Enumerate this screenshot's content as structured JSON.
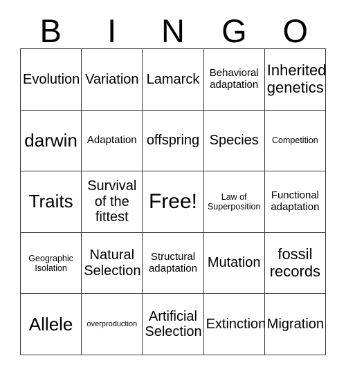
{
  "card": {
    "title": "BINGO",
    "background_color": "#ffffff",
    "border_color": "#3a3a3a",
    "text_color": "#000000"
  },
  "header": {
    "letters": [
      {
        "label": "B"
      },
      {
        "label": "I"
      },
      {
        "label": "N"
      },
      {
        "label": "G"
      },
      {
        "label": "O"
      }
    ]
  },
  "grid": {
    "rows": 5,
    "columns": 5,
    "cells": [
      {
        "label": "Evolution",
        "size": "sz-md"
      },
      {
        "label": "Variation",
        "size": "sz-md"
      },
      {
        "label": "Lamarck",
        "size": "sz-md"
      },
      {
        "label": "Behavioral\nadaptation",
        "size": "sz-xs"
      },
      {
        "label": "Inherited\ngenetics",
        "size": "sz-ml"
      },
      {
        "label": "darwin",
        "size": "sz-lg"
      },
      {
        "label": "Adaptation",
        "size": "sz-xs"
      },
      {
        "label": "offspring",
        "size": "sz-md"
      },
      {
        "label": "Species",
        "size": "sz-md"
      },
      {
        "label": "Competition",
        "size": "sz-xxs"
      },
      {
        "label": "Traits",
        "size": "sz-lg"
      },
      {
        "label": "Survival\nof the\nfittest",
        "size": "sz-md"
      },
      {
        "label": "Free!",
        "size": "sz-xl"
      },
      {
        "label": "Law of\nSuperposition",
        "size": "sz-xxs"
      },
      {
        "label": "Functional\nadaptation",
        "size": "sz-xs"
      },
      {
        "label": "Geographic\nIsolation",
        "size": "sz-xxs"
      },
      {
        "label": "Natural\nSelection",
        "size": "sz-md"
      },
      {
        "label": "Structural\nadaptation",
        "size": "sz-xs"
      },
      {
        "label": "Mutation",
        "size": "sz-md"
      },
      {
        "label": "fossil\nrecords",
        "size": "sz-ml"
      },
      {
        "label": "Allele",
        "size": "sz-lg"
      },
      {
        "label": "overproduction",
        "size": "sz-tiny"
      },
      {
        "label": "Artificial\nSelection",
        "size": "sz-md"
      },
      {
        "label": "Extinction",
        "size": "sz-md"
      },
      {
        "label": "Migration",
        "size": "sz-md"
      }
    ]
  }
}
